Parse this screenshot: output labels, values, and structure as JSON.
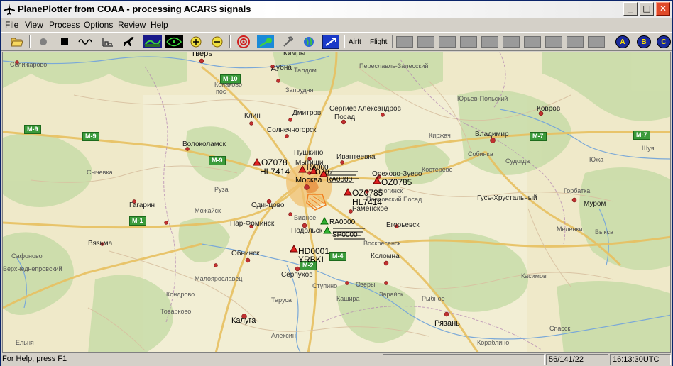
{
  "window": {
    "title": "PlanePlotter from COAA - processing ACARS signals",
    "controls": {
      "minimize": "_",
      "maximize": "□",
      "close": "✕"
    }
  },
  "menu": [
    "File",
    "View",
    "Process",
    "Options",
    "Review",
    "Help"
  ],
  "toolbar": {
    "aircraft_label": "Airft",
    "flight_label": "Flight",
    "circle_buttons": [
      "A",
      "B",
      "C"
    ]
  },
  "map": {
    "cities": [
      {
        "name": "Тверь",
        "cls": "big"
      },
      {
        "name": "Кимры",
        "cls": ""
      },
      {
        "name": "Дубна",
        "cls": ""
      },
      {
        "name": "Талдом",
        "cls": "small"
      },
      {
        "name": "Переславль-Залесский",
        "cls": "small"
      },
      {
        "name": "Селижарово",
        "cls": "small"
      },
      {
        "name": "Запрудня",
        "cls": "small"
      },
      {
        "name": "Конаково",
        "cls": "small"
      },
      {
        "name": "пос",
        "cls": "small"
      },
      {
        "name": "Клин",
        "cls": ""
      },
      {
        "name": "Дмитров",
        "cls": ""
      },
      {
        "name": "Сергиев",
        "cls": ""
      },
      {
        "name": "Посад",
        "cls": ""
      },
      {
        "name": "Александров",
        "cls": ""
      },
      {
        "name": "Юрьев-Польский",
        "cls": "small"
      },
      {
        "name": "Ковров",
        "cls": ""
      },
      {
        "name": "Солнечногорск",
        "cls": ""
      },
      {
        "name": "Волоколамск",
        "cls": ""
      },
      {
        "name": "Пушкино",
        "cls": ""
      },
      {
        "name": "Ивантеевка",
        "cls": ""
      },
      {
        "name": "Киржач",
        "cls": "small"
      },
      {
        "name": "Владимир",
        "cls": ""
      },
      {
        "name": "Собинка",
        "cls": "small"
      },
      {
        "name": "Мытищи",
        "cls": ""
      },
      {
        "name": "Москва",
        "cls": "big"
      },
      {
        "name": "Орехово-Зуево",
        "cls": ""
      },
      {
        "name": "Костерево",
        "cls": "small"
      },
      {
        "name": "Судогда",
        "cls": "small"
      },
      {
        "name": "Южа",
        "cls": "small"
      },
      {
        "name": "Шуя",
        "cls": "small"
      },
      {
        "name": "Сычевка",
        "cls": "small"
      },
      {
        "name": "Гагарин",
        "cls": ""
      },
      {
        "name": "Руза",
        "cls": "small"
      },
      {
        "name": "Одинцово",
        "cls": ""
      },
      {
        "name": "Ногинск",
        "cls": "small"
      },
      {
        "name": "Павловский Посад",
        "cls": "small"
      },
      {
        "name": "Раменское",
        "cls": ""
      },
      {
        "name": "Гусь-Хрустальный",
        "cls": ""
      },
      {
        "name": "Горбатка",
        "cls": "small"
      },
      {
        "name": "Муром",
        "cls": ""
      },
      {
        "name": "Можайск",
        "cls": "small"
      },
      {
        "name": "Нар-Фоминск",
        "cls": ""
      },
      {
        "name": "Видное",
        "cls": "small"
      },
      {
        "name": "Подольск",
        "cls": ""
      },
      {
        "name": "Егорьевск",
        "cls": ""
      },
      {
        "name": "Меленки",
        "cls": "small"
      },
      {
        "name": "Выкса",
        "cls": "small"
      },
      {
        "name": "Вязьма",
        "cls": ""
      },
      {
        "name": "Сафоново",
        "cls": "small"
      },
      {
        "name": "Обнинск",
        "cls": ""
      },
      {
        "name": "Воскресенск",
        "cls": "small"
      },
      {
        "name": "Коломна",
        "cls": ""
      },
      {
        "name": "Верхнеднепровский",
        "cls": "small"
      },
      {
        "name": "Малоярославец",
        "cls": "small"
      },
      {
        "name": "Серпухов",
        "cls": ""
      },
      {
        "name": "Касимов",
        "cls": "small"
      },
      {
        "name": "Ступино",
        "cls": "small"
      },
      {
        "name": "Озеры",
        "cls": "small"
      },
      {
        "name": "Зарайск",
        "cls": "small"
      },
      {
        "name": "Кондрово",
        "cls": "small"
      },
      {
        "name": "Таруса",
        "cls": "small"
      },
      {
        "name": "Кашира",
        "cls": "small"
      },
      {
        "name": "Рыбное",
        "cls": "small"
      },
      {
        "name": "Калуга",
        "cls": "big"
      },
      {
        "name": "Рязань",
        "cls": "big"
      },
      {
        "name": "Алексин",
        "cls": "small"
      },
      {
        "name": "Товарково",
        "cls": "small"
      },
      {
        "name": "Ельня",
        "cls": "small"
      },
      {
        "name": "Спасск",
        "cls": "small"
      },
      {
        "name": "Кораблино",
        "cls": "small"
      }
    ],
    "roads": [
      "M-10",
      "M-9",
      "M-9",
      "M-9",
      "M-7",
      "M-7",
      "M-1",
      "M-2",
      "M-4"
    ],
    "planes": [
      {
        "label": "OZ078",
        "status": "red"
      },
      {
        "label": "HL7414",
        "status": "red"
      },
      {
        "label": "RA000",
        "status": "red"
      },
      {
        "label": "OZ07",
        "status": "red"
      },
      {
        "label": "RA0000",
        "status": "red"
      },
      {
        "label": "OZ0785",
        "status": "red"
      },
      {
        "label": "OZ0785",
        "status": "red"
      },
      {
        "label": "HL7414",
        "status": "red"
      },
      {
        "label": "RA0000",
        "status": "green"
      },
      {
        "label": "SP0000",
        "status": "green"
      },
      {
        "label": "HD0001",
        "status": "red"
      },
      {
        "label": "YRBKI",
        "status": "red"
      }
    ]
  },
  "status": {
    "help": "For Help, press F1",
    "counts": "56/141/22",
    "time": "16:13:30UTC"
  }
}
